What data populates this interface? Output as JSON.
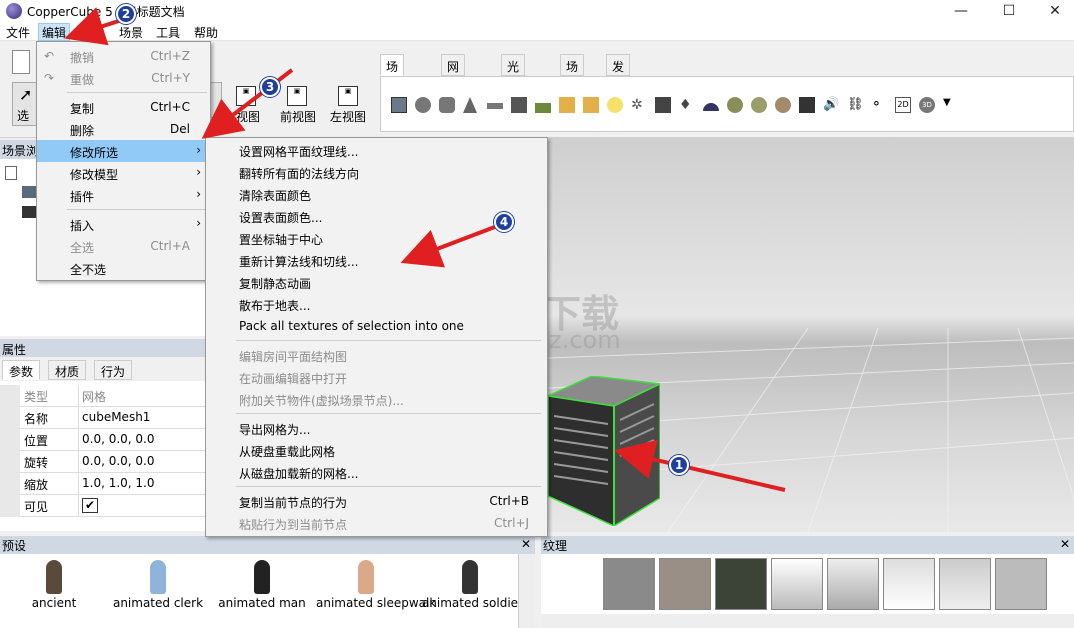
{
  "window": {
    "title": "CopperCube 5 - 无标题文档",
    "minimize_glyph": "—",
    "maximize_glyph": "☐",
    "close_glyph": "✕"
  },
  "menubar": {
    "items": [
      "文件",
      "编辑",
      "场景",
      "工具",
      "帮助"
    ]
  },
  "toolbar": {
    "select_label": "选",
    "view_buttons": [
      "视图",
      "前视图",
      "左视图"
    ]
  },
  "tabs": [
    "场景编辑",
    "网格编辑",
    "光照贴图",
    "场景",
    "发布"
  ],
  "scene_panel": {
    "header": "场景浏"
  },
  "properties": {
    "header": "属性",
    "tabs": [
      "参数",
      "材质",
      "行为"
    ],
    "rows": [
      {
        "key": "类型",
        "value": "网格"
      },
      {
        "key": "名称",
        "value": "cubeMesh1"
      },
      {
        "key": "位置",
        "value": "0.0, 0.0, 0.0"
      },
      {
        "key": "旋转",
        "value": "0.0, 0.0, 0.0"
      },
      {
        "key": "缩放",
        "value": "1.0, 1.0, 1.0"
      },
      {
        "key": "可见",
        "value": "✔"
      }
    ]
  },
  "edit_menu": {
    "items": [
      {
        "label": "撤销",
        "shortcut": "Ctrl+Z",
        "disabled": true
      },
      {
        "label": "重做",
        "shortcut": "Ctrl+Y",
        "disabled": true
      },
      {
        "label": "复制",
        "shortcut": "Ctrl+C"
      },
      {
        "label": "删除",
        "shortcut": "Del"
      },
      {
        "label": "修改所选",
        "shortcut": "›",
        "highlighted": true
      },
      {
        "label": "修改模型",
        "shortcut": "›"
      },
      {
        "label": "插件",
        "shortcut": "›"
      },
      {
        "label": "插入",
        "shortcut": "›"
      },
      {
        "label": "全选",
        "shortcut": "Ctrl+A",
        "disabled": true
      },
      {
        "label": "全不选",
        "shortcut": ""
      }
    ]
  },
  "submenu": {
    "items": [
      {
        "label": "设置网格平面纹理线..."
      },
      {
        "label": "翻转所有面的法线方向"
      },
      {
        "label": "清除表面颜色"
      },
      {
        "label": "设置表面颜色..."
      },
      {
        "label": "置坐标轴于中心"
      },
      {
        "label": "重新计算法线和切线..."
      },
      {
        "label": "复制静态动画"
      },
      {
        "label": "散布于地表..."
      },
      {
        "label": "Pack all textures of selection into one"
      },
      {
        "label": "编辑房间平面结构图",
        "disabled": true
      },
      {
        "label": "在动画编辑器中打开",
        "disabled": true
      },
      {
        "label": "附加关节物件(虚拟场景节点)...",
        "disabled": true
      },
      {
        "label": "导出网格为..."
      },
      {
        "label": "从硬盘重载此网格"
      },
      {
        "label": "从磁盘加载新的网格..."
      },
      {
        "label": "复制当前节点的行为",
        "shortcut": "Ctrl+B"
      },
      {
        "label": "粘贴行为到当前节点",
        "shortcut": "Ctrl+J",
        "disabled": true
      }
    ]
  },
  "presets": {
    "header": "预设",
    "close_glyph": "✕",
    "items": [
      "ancient",
      "animated clerk",
      "animated man",
      "animated sleepwalk",
      "animated soldie"
    ]
  },
  "textures": {
    "header": "纹理",
    "close_glyph": "✕"
  },
  "watermark": {
    "text": "安下载",
    "sub": "anxz.com"
  },
  "annotations": [
    "1",
    "2",
    "3",
    "4"
  ],
  "colors": {
    "menu_highlight": "#91c9f7",
    "badge": "#1f3fa0",
    "arrow": "#e02020",
    "panel_header": "#cfd8e3"
  }
}
